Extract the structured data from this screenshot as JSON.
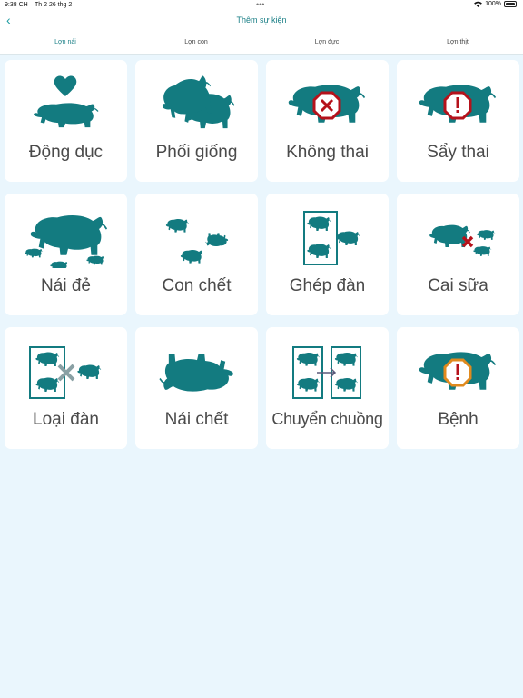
{
  "status_bar": {
    "time": "9:38 CH",
    "date": "Th 2 26 thg 2",
    "battery": "100%"
  },
  "header": {
    "title": "Thêm sự kiện"
  },
  "tabs": [
    {
      "label": "Lợn nái",
      "active": true
    },
    {
      "label": "Lợn con",
      "active": false
    },
    {
      "label": "Lợn đực",
      "active": false
    },
    {
      "label": "Lợn thịt",
      "active": false
    }
  ],
  "events": [
    {
      "label": "Động dục",
      "icon": "heat-icon"
    },
    {
      "label": "Phối giống",
      "icon": "breeding-icon"
    },
    {
      "label": "Không thai",
      "icon": "not-pregnant-icon"
    },
    {
      "label": "Sẩy thai",
      "icon": "miscarriage-icon"
    },
    {
      "label": "Nái đẻ",
      "icon": "farrowing-icon"
    },
    {
      "label": "Con chết",
      "icon": "piglet-death-icon"
    },
    {
      "label": "Ghép đàn",
      "icon": "merge-herd-icon"
    },
    {
      "label": "Cai sữa",
      "icon": "weaning-icon"
    },
    {
      "label": "Loại đàn",
      "icon": "cull-herd-icon"
    },
    {
      "label": "Nái chết",
      "icon": "sow-death-icon"
    },
    {
      "label": "Chuyển chuồng",
      "icon": "transfer-pen-icon"
    },
    {
      "label": "Bệnh",
      "icon": "disease-icon"
    }
  ],
  "colors": {
    "teal": "#137b80",
    "accent": "#1a9aa0",
    "warn_red": "#b5121b",
    "warn_orange": "#e08a1e"
  }
}
